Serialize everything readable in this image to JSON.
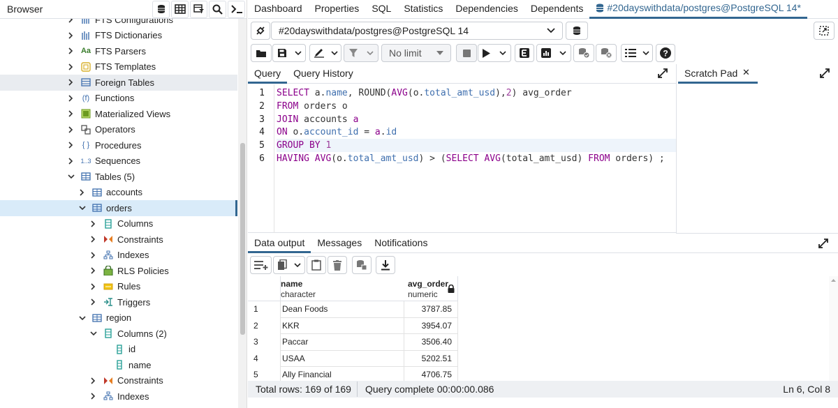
{
  "browser": {
    "title": "Browser",
    "tree": [
      {
        "label": "FTS Configurations",
        "indent": 1,
        "expanded": false,
        "icon": "fts-configurations-icon"
      },
      {
        "label": "FTS Dictionaries",
        "indent": 1,
        "expanded": false,
        "icon": "fts-dictionaries-icon"
      },
      {
        "label": "FTS Parsers",
        "indent": 1,
        "expanded": false,
        "icon": "fts-parsers-icon"
      },
      {
        "label": "FTS Templates",
        "indent": 1,
        "expanded": false,
        "icon": "fts-templates-icon"
      },
      {
        "label": "Foreign Tables",
        "indent": 1,
        "expanded": false,
        "icon": "foreign-tables-icon"
      },
      {
        "label": "Functions",
        "indent": 1,
        "expanded": false,
        "icon": "functions-icon"
      },
      {
        "label": "Materialized Views",
        "indent": 1,
        "expanded": false,
        "icon": "materialized-views-icon"
      },
      {
        "label": "Operators",
        "indent": 1,
        "expanded": false,
        "icon": "operators-icon"
      },
      {
        "label": "Procedures",
        "indent": 1,
        "expanded": false,
        "icon": "procedures-icon"
      },
      {
        "label": "Sequences",
        "indent": 1,
        "expanded": false,
        "icon": "sequences-icon"
      },
      {
        "label": "Tables (5)",
        "indent": 1,
        "expanded": true,
        "icon": "tables-icon"
      },
      {
        "label": "accounts",
        "indent": 2,
        "expanded": false,
        "icon": "table-icon"
      },
      {
        "label": "orders",
        "indent": 2,
        "expanded": true,
        "icon": "table-icon"
      },
      {
        "label": "Columns",
        "indent": 3,
        "expanded": false,
        "icon": "columns-icon"
      },
      {
        "label": "Constraints",
        "indent": 3,
        "expanded": false,
        "icon": "constraints-icon"
      },
      {
        "label": "Indexes",
        "indent": 3,
        "expanded": false,
        "icon": "indexes-icon"
      },
      {
        "label": "RLS Policies",
        "indent": 3,
        "expanded": false,
        "icon": "rls-policies-icon"
      },
      {
        "label": "Rules",
        "indent": 3,
        "expanded": false,
        "icon": "rules-icon"
      },
      {
        "label": "Triggers",
        "indent": 3,
        "expanded": false,
        "icon": "triggers-icon"
      },
      {
        "label": "region",
        "indent": 2,
        "expanded": true,
        "icon": "table-icon"
      },
      {
        "label": "Columns (2)",
        "indent": 3,
        "expanded": true,
        "icon": "columns-icon"
      },
      {
        "label": "id",
        "indent": 4,
        "expanded": null,
        "icon": "column-icon"
      },
      {
        "label": "name",
        "indent": 4,
        "expanded": null,
        "icon": "column-icon"
      },
      {
        "label": "Constraints",
        "indent": 3,
        "expanded": false,
        "icon": "constraints-icon"
      },
      {
        "label": "Indexes",
        "indent": 3,
        "expanded": false,
        "icon": "indexes-icon"
      }
    ]
  },
  "main_tabs": [
    "Dashboard",
    "Properties",
    "SQL",
    "Statistics",
    "Dependencies",
    "Dependents",
    "#20dayswithdata/postgres@PostgreSQL 14*"
  ],
  "connection": {
    "label": "#20dayswithdata/postgres@PostgreSQL 14"
  },
  "toolbar": {
    "limit": "No limit"
  },
  "query_tabs": [
    "Query",
    "Query History"
  ],
  "scratch_pad": {
    "label": "Scratch Pad"
  },
  "editor": {
    "line_numbers": [
      "1",
      "2",
      "3",
      "4",
      "5",
      "6"
    ],
    "lines": [
      [
        [
          "kw",
          "SELECT"
        ],
        [
          "t",
          " "
        ],
        [
          "t",
          "a"
        ],
        [
          "t",
          "."
        ],
        [
          "tk",
          "name"
        ],
        [
          "t",
          ", ROUND("
        ],
        [
          "fn",
          "AVG"
        ],
        [
          "t",
          "(o."
        ],
        [
          "tk",
          "total_amt_usd"
        ],
        [
          "t",
          "),"
        ],
        [
          "num",
          "2"
        ],
        [
          "t",
          ") avg_order"
        ]
      ],
      [
        [
          "kw",
          "FROM"
        ],
        [
          "t",
          " orders o"
        ]
      ],
      [
        [
          "kw",
          "JOIN"
        ],
        [
          "t",
          " accounts "
        ],
        [
          "kw",
          "a"
        ]
      ],
      [
        [
          "kw",
          "ON"
        ],
        [
          "t",
          " o."
        ],
        [
          "tk",
          "account_id"
        ],
        [
          "t",
          " = "
        ],
        [
          "kw",
          "a"
        ],
        [
          "t",
          "."
        ],
        [
          "tk",
          "id"
        ]
      ],
      [
        [
          "kw",
          "GROUP BY"
        ],
        [
          "t",
          " "
        ],
        [
          "num",
          "1"
        ]
      ],
      [
        [
          "kw",
          "HAVING"
        ],
        [
          "t",
          " "
        ],
        [
          "fn",
          "AVG"
        ],
        [
          "t",
          "(o."
        ],
        [
          "tk",
          "total_amt_usd"
        ],
        [
          "t",
          ") > ("
        ],
        [
          "kw",
          "SELECT"
        ],
        [
          "t",
          " "
        ],
        [
          "fn",
          "AVG"
        ],
        [
          "t",
          "(total_amt_usd) "
        ],
        [
          "kw",
          "FROM"
        ],
        [
          "t",
          " orders) ;"
        ]
      ]
    ]
  },
  "output_tabs": [
    "Data output",
    "Messages",
    "Notifications"
  ],
  "grid": {
    "columns": [
      {
        "name": "name",
        "type": "character"
      },
      {
        "name": "avg_order",
        "type": "numeric"
      }
    ],
    "rows": [
      [
        "1",
        "Dean Foods",
        "3787.85"
      ],
      [
        "2",
        "KKR",
        "3954.07"
      ],
      [
        "3",
        "Paccar",
        "3506.40"
      ],
      [
        "4",
        "USAA",
        "5202.51"
      ],
      [
        "5",
        "Ally Financial",
        "4706.75"
      ]
    ]
  },
  "status": {
    "total_rows": "Total rows: 169 of 169",
    "query_complete": "Query complete 00:00:00.086",
    "cursor": "Ln 6, Col 8"
  },
  "colors": {
    "accent": "#326690",
    "keyword": "#8b008b",
    "token": "#3f6fae"
  }
}
